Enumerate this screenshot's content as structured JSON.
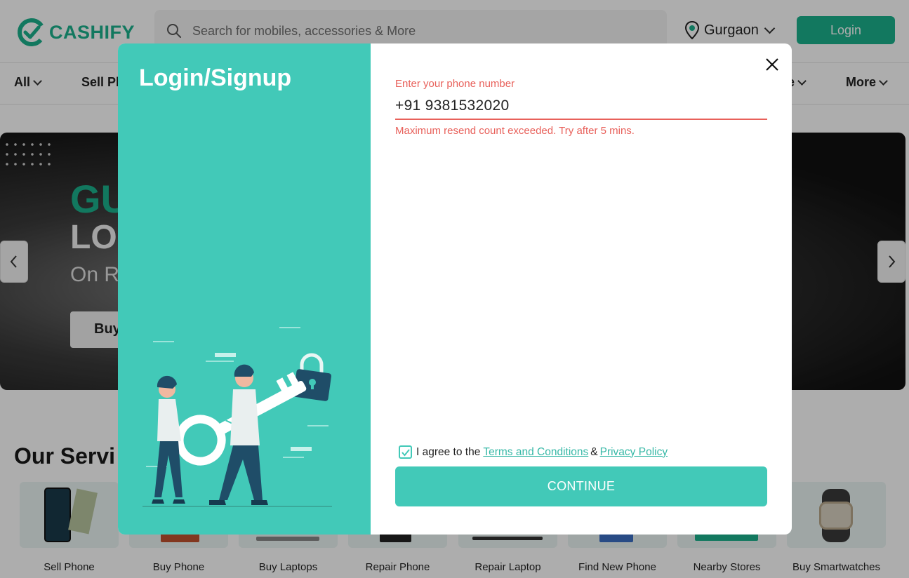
{
  "header": {
    "logo_text": "CASHIFY",
    "search_placeholder": "Search for mobiles, accessories & More",
    "location": "Gurgaon",
    "login_label": "Login"
  },
  "nav": {
    "items": [
      {
        "label": "All"
      },
      {
        "label": "Sell Ph"
      },
      {
        "label": "e"
      },
      {
        "label": "More"
      }
    ]
  },
  "banner": {
    "line1": "GU",
    "line2": "LO",
    "line3": "On Re",
    "button": "Buy"
  },
  "services": {
    "title": "Our Servi",
    "items": [
      {
        "label": "Sell Phone"
      },
      {
        "label": "Buy Phone"
      },
      {
        "label": "Buy Laptops"
      },
      {
        "label": "Repair Phone"
      },
      {
        "label": "Repair Laptop"
      },
      {
        "label": "Find New Phone"
      },
      {
        "label": "Nearby Stores"
      },
      {
        "label": "Buy Smartwatches"
      }
    ]
  },
  "modal": {
    "title": "Login/Signup",
    "phone_label": "Enter your phone number",
    "phone_value": "+91 9381532020",
    "error": "Maximum resend count exceeded. Try after 5 mins.",
    "agree_text": "I agree to the",
    "terms_link": "Terms and Conditions",
    "amp": "&",
    "privacy_link": "Privacy Policy",
    "continue_label": "CONTINUE",
    "checkbox_checked": true
  },
  "colors": {
    "brand": "#1bb28c",
    "modal_accent": "#42c9b8",
    "error": "#e8605a"
  }
}
